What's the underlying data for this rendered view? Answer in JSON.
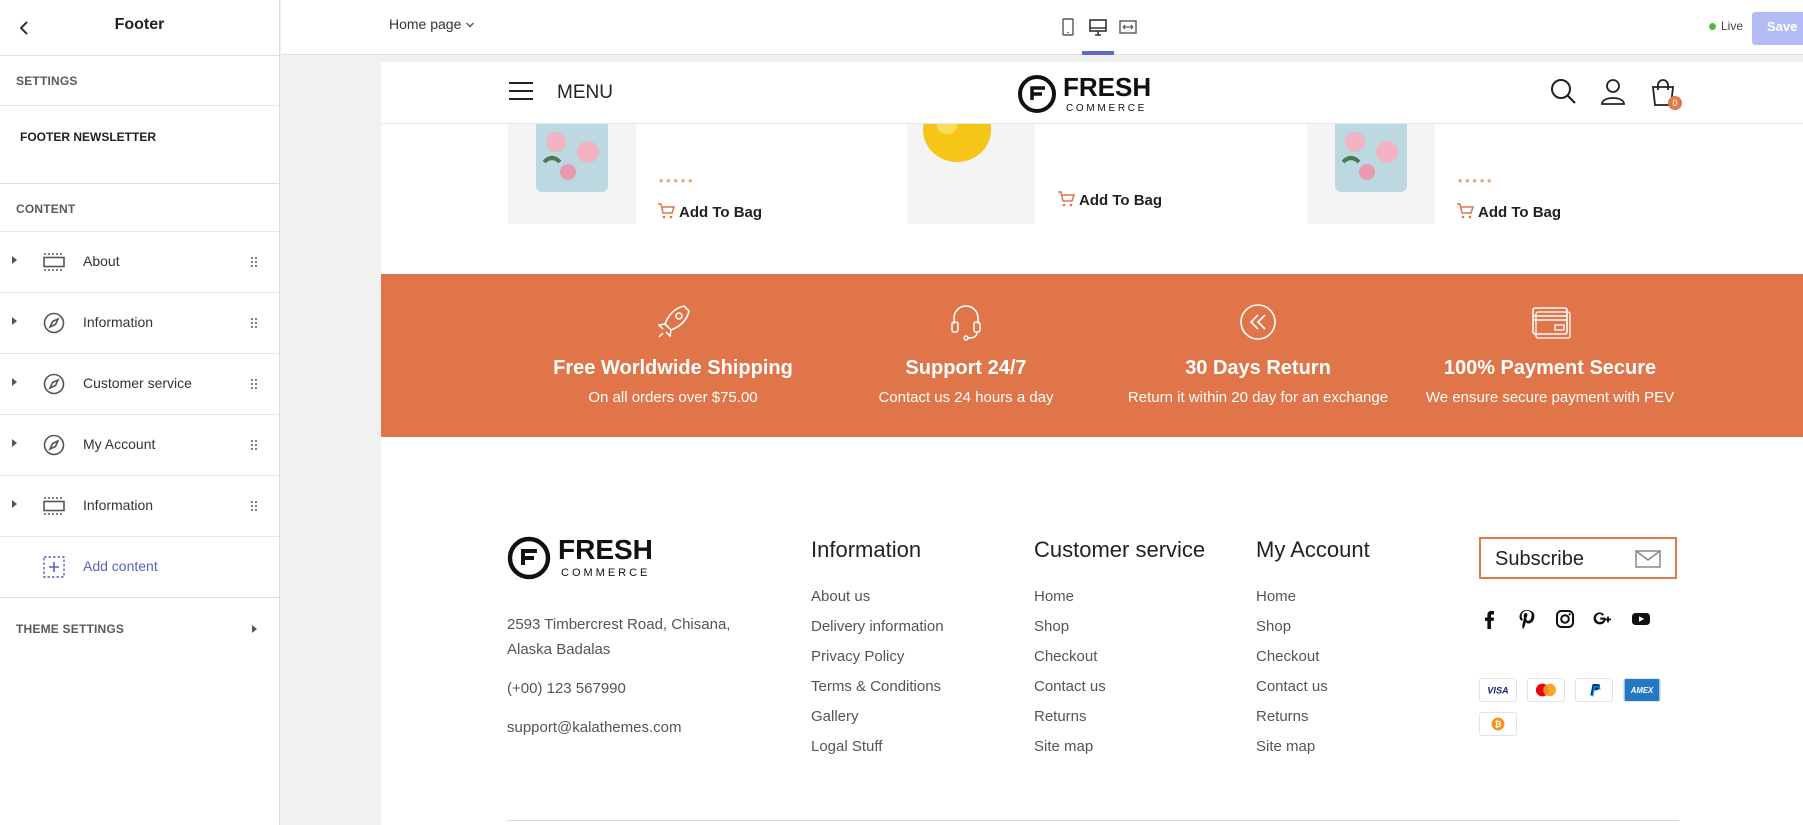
{
  "sidebar": {
    "title": "Footer",
    "sections": {
      "settings": "SETTINGS",
      "content": "CONTENT",
      "theme": "THEME SETTINGS"
    },
    "newsletter": "FOOTER NEWSLETTER",
    "items": [
      {
        "label": "About",
        "icon": "section-icon"
      },
      {
        "label": "Information",
        "icon": "compass-icon"
      },
      {
        "label": "Customer service",
        "icon": "compass-icon"
      },
      {
        "label": "My Account",
        "icon": "compass-icon"
      },
      {
        "label": "Information",
        "icon": "section-icon"
      }
    ],
    "add_content": "Add content"
  },
  "topbar": {
    "page_select": "Home page",
    "devices": [
      "mobile-icon",
      "desktop-icon",
      "fullwidth-icon"
    ],
    "active_device": "desktop",
    "live_label": "Live",
    "save_label": "Save"
  },
  "store": {
    "menu_label": "MENU",
    "logo": {
      "word": "FRESH",
      "sub": "COMMERCE"
    },
    "bag_count": "0",
    "add_to_bag": "Add To Bag",
    "accent": "#df7548"
  },
  "services": [
    {
      "icon": "rocket-icon",
      "title": "Free Worldwide Shipping",
      "subtitle": "On all orders over $75.00"
    },
    {
      "icon": "headset-icon",
      "title": "Support 24/7",
      "subtitle": "Contact us 24 hours a day"
    },
    {
      "icon": "return-icon",
      "title": "30 Days Return",
      "subtitle": "Return it within 20 day for an exchange"
    },
    {
      "icon": "card-icon",
      "title": "100% Payment Secure",
      "subtitle": "We ensure secure payment with PEV"
    }
  ],
  "footer": {
    "address1": "2593 Timbercrest Road, Chisana,",
    "address2": "Alaska Badalas",
    "phone": "(+00) 123 567990",
    "email": "support@kalathemes.com",
    "columns": [
      {
        "title": "Information",
        "links": [
          "About us",
          "Delivery information",
          "Privacy Policy",
          "Terms & Conditions",
          "Gallery",
          "Logal Stuff"
        ]
      },
      {
        "title": "Customer service",
        "links": [
          "Home",
          "Shop",
          "Checkout",
          "Contact us",
          "Returns",
          "Site map"
        ]
      },
      {
        "title": "My Account",
        "links": [
          "Home",
          "Shop",
          "Checkout",
          "Contact us",
          "Returns",
          "Site map"
        ]
      }
    ],
    "subscribe_label": "Subscribe",
    "social": [
      "facebook-icon",
      "pinterest-icon",
      "instagram-icon",
      "google-plus-icon",
      "youtube-icon"
    ],
    "payments": [
      "visa-icon",
      "mastercard-icon",
      "paypal-icon",
      "amex-icon",
      "bitcoin-icon"
    ]
  }
}
